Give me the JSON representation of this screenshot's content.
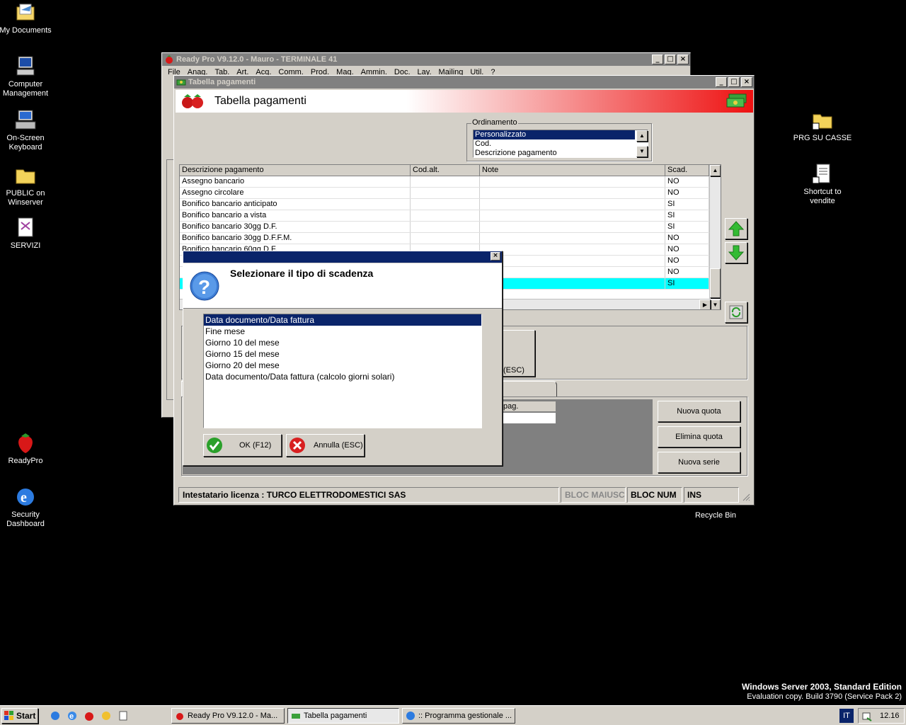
{
  "desktop": {
    "icons": [
      {
        "label": "My Documents"
      },
      {
        "label": "Computer Management"
      },
      {
        "label": "On-Screen Keyboard"
      },
      {
        "label": "PUBLIC on Winserver"
      },
      {
        "label": "SERVIZI"
      },
      {
        "label": "ReadyPro"
      },
      {
        "label": "Security Dashboard"
      },
      {
        "label": "PRG SU CASSE"
      },
      {
        "label": "Shortcut to vendite"
      },
      {
        "label": "Recycle Bin"
      }
    ],
    "os_edition": "Windows Server 2003, Standard Edition",
    "os_build": "Evaluation copy. Build 3790 (Service Pack 2)"
  },
  "main_window": {
    "title": "Ready Pro V9.12.0 - Mauro - TERMINALE 41",
    "menu": [
      "File",
      "Anag.",
      "Tab.",
      "Art.",
      "Acq.",
      "Comm.",
      "Prod.",
      "Mag.",
      "Ammin.",
      "Doc.",
      "Lay.",
      "Mailing",
      "Util.",
      "?"
    ]
  },
  "payments_window": {
    "title": "Tabella pagamenti",
    "header": "Tabella pagamenti",
    "ordinamento": {
      "legend": "Ordinamento",
      "options": [
        "Personalizzato",
        "Cod.",
        "Descrizione pagamento"
      ],
      "selected": "Personalizzato"
    },
    "grid": {
      "columns": [
        "Descrizione pagamento",
        "Cod.alt.",
        "Note",
        "Scad."
      ],
      "rows": [
        {
          "desc": "Assegno bancario",
          "cod": "",
          "note": "",
          "scad": "NO"
        },
        {
          "desc": "Assegno circolare",
          "cod": "",
          "note": "",
          "scad": "NO"
        },
        {
          "desc": "Bonifico bancario anticipato",
          "cod": "",
          "note": "",
          "scad": "SI"
        },
        {
          "desc": "Bonifico bancario a vista",
          "cod": "",
          "note": "",
          "scad": "SI"
        },
        {
          "desc": "Bonifico bancario 30gg D.F.",
          "cod": "",
          "note": "",
          "scad": "SI"
        },
        {
          "desc": "Bonifico bancario 30gg D.F.F.M.",
          "cod": "",
          "note": "",
          "scad": "NO"
        },
        {
          "desc": "Bonifico bancario 60gg D.F.",
          "cod": "",
          "note": "",
          "scad": "NO"
        },
        {
          "desc": "",
          "cod": "",
          "note": "",
          "scad": "NO"
        },
        {
          "desc": "",
          "cod": "",
          "note": "",
          "scad": "NO"
        },
        {
          "desc": "",
          "cod": "",
          "note": "",
          "scad": "SI"
        }
      ]
    },
    "esc_label": "(ESC)",
    "pag_header": "pag.",
    "buttons": {
      "nuova_quota": "Nuova quota",
      "elimina_quota": "Elimina quota",
      "nuova_serie": "Nuova serie"
    },
    "status": {
      "license": "Intestatario licenza : TURCO ELETTRODOMESTICI SAS",
      "caps": "BLOC MAIUSC",
      "num": "BLOC NUM",
      "ins": "INS"
    }
  },
  "dialog": {
    "question": "Selezionare il tipo di scadenza",
    "options": [
      "Data documento/Data fattura",
      "Fine mese",
      "Giorno 10 del mese",
      "Giorno 15 del mese",
      "Giorno 20 del mese",
      "Data documento/Data fattura (calcolo giorni solari)"
    ],
    "selected_index": 0,
    "ok_label": "OK (F12)",
    "cancel_label": "Annulla (ESC)"
  },
  "taskbar": {
    "start": "Start",
    "items": [
      {
        "label": "Ready Pro V9.12.0 - Ma..."
      },
      {
        "label": "Tabella pagamenti"
      },
      {
        "label": ":: Programma gestionale ..."
      }
    ],
    "lang": "IT",
    "clock": "12.16"
  },
  "colors": {
    "selection": "#0a246a",
    "highlight_row": "#00ffff",
    "header_gradient_end": "#ee1111",
    "arrow_green": "#33bb33"
  }
}
